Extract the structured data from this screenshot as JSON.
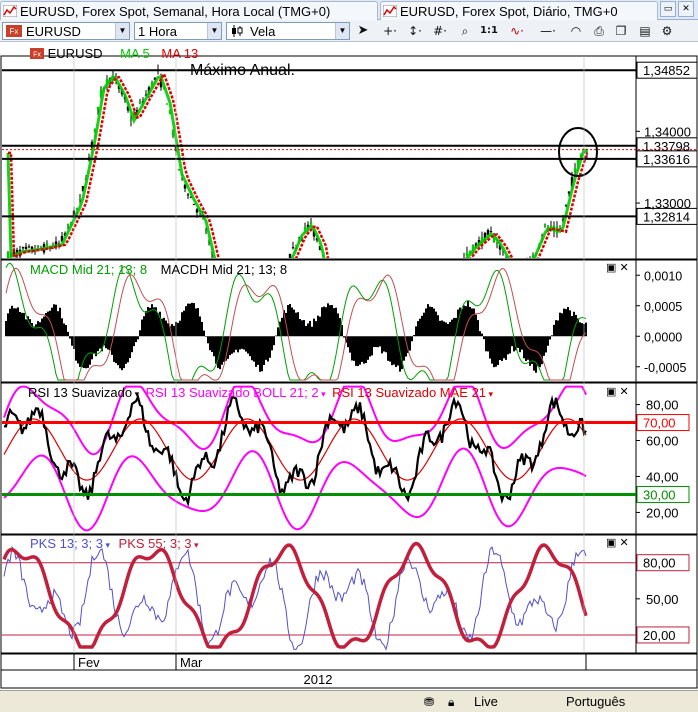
{
  "tabs": [
    {
      "label": "EURUSD, Forex Spot, Semanal, Hora Local (TMG+0)"
    },
    {
      "label": "EURUSD, Forex Spot, Diário, TMG+0"
    }
  ],
  "toolbar": {
    "symbol": "EURUSD",
    "interval": "1 Hora",
    "chart_type": "Vela"
  },
  "colors": {
    "up_candle": "#00c800",
    "ma5": "#00cc00",
    "ma13": "#e00000",
    "macd": "#00a000",
    "macdh": "#000000",
    "rsi_boll": "#ff00ff",
    "rsi_mae": "#e00000",
    "pks13": "#5050d0",
    "pks55": "#c0203c",
    "level_red": "#ff0000",
    "level_green": "#009000",
    "selection_highlight": "#f0f4fa"
  },
  "panels": {
    "price": {
      "legend": {
        "symbol": "EURUSD",
        "ma5": "MA 5",
        "ma13": "MA 13"
      },
      "annotation": "Máximo Anual.",
      "levels": [
        {
          "value": 1.34852,
          "label": "1,34852"
        },
        {
          "value": 1.33798,
          "label": "1,33798"
        },
        {
          "value": 1.33616,
          "label": "1,33616"
        },
        {
          "value": 1.32814,
          "label": "1,32814"
        }
      ],
      "ticks": [
        {
          "value": 1.34,
          "label": "1,34000"
        },
        {
          "value": 1.33,
          "label": "1,33000"
        }
      ]
    },
    "macd": {
      "legend": {
        "macd": "MACD Mid  21; 13; 8",
        "macdh": "MACDH Mid  21; 13; 8"
      },
      "ticks": [
        {
          "value": 0.001,
          "label": "0,0010"
        },
        {
          "value": 0.0005,
          "label": "0,0005"
        },
        {
          "value": 0.0,
          "label": "0,0000"
        },
        {
          "value": -0.0005,
          "label": "-0,0005"
        }
      ]
    },
    "rsi": {
      "legend": {
        "rsi": "RSI 13 Suavizado",
        "boll": "RSI 13 Suavizado BOLL 21; 2",
        "mae": "RSI 13 Suavizado MAE 21"
      },
      "ticks": [
        {
          "value": 80,
          "label": "80,00"
        },
        {
          "value": 60,
          "label": "60,00"
        },
        {
          "value": 40,
          "label": "40,00"
        },
        {
          "value": 20,
          "label": "20,00"
        }
      ],
      "levels": [
        {
          "value": 70,
          "label": "70,00",
          "color": "#ff0000"
        },
        {
          "value": 30,
          "label": "30,00",
          "color": "#009000"
        }
      ]
    },
    "pks": {
      "legend": {
        "pks13": "PKS 13; 3; 3",
        "pks55": "PKS 55; 3; 3"
      },
      "ticks": [
        {
          "value": 50,
          "label": "50,00"
        }
      ],
      "levels": [
        {
          "value": 80,
          "label": "80,00",
          "color": "#c0203c"
        },
        {
          "value": 20,
          "label": "20,00",
          "color": "#c0203c"
        }
      ]
    }
  },
  "xaxis": {
    "months": [
      "Fev",
      "Mar"
    ],
    "year": "2012"
  },
  "status": {
    "connection": "Live",
    "language": "Português"
  }
}
